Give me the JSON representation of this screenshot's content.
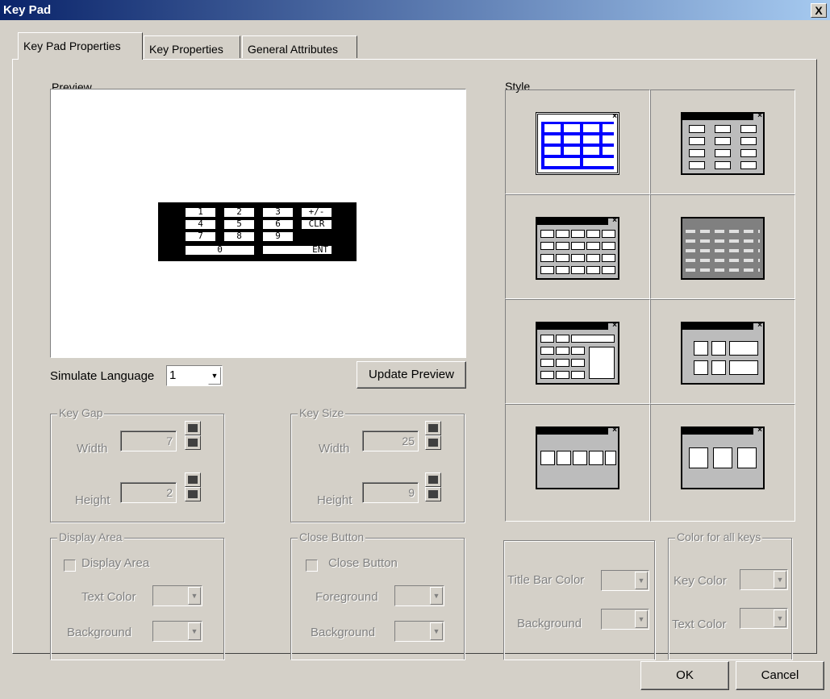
{
  "window": {
    "title": "Key Pad",
    "close_symbol": "X"
  },
  "tabs": [
    {
      "label": "Key Pad Properties",
      "active": true
    },
    {
      "label": "Key  Properties",
      "active": false
    },
    {
      "label": "General Attributes",
      "active": false
    }
  ],
  "preview": {
    "label": "Preview",
    "keypad_keys": [
      "1",
      "2",
      "3",
      "+/-",
      "4",
      "5",
      "6",
      "CLR",
      "7",
      "8",
      "9",
      "0",
      "ENT"
    ]
  },
  "simulate_language": {
    "label": "Simulate Language",
    "value": "1"
  },
  "update_preview_label": "Update Preview",
  "key_gap": {
    "label": "Key Gap",
    "width_label": "Width",
    "width_value": "7",
    "height_label": "Height",
    "height_value": "2"
  },
  "key_size": {
    "label": "Key Size",
    "width_label": "Width",
    "width_value": "25",
    "height_label": "Height",
    "height_value": "9"
  },
  "display_area": {
    "label": "Display Area",
    "checkbox_label": "Display Area",
    "text_color_label": "Text Color",
    "background_label": "Background"
  },
  "close_button": {
    "label": "Close Button",
    "checkbox_label": "Close Button",
    "foreground_label": "Foreground",
    "background_label": "Background"
  },
  "style": {
    "label": "Style",
    "selected_index": 0,
    "options_count": 8
  },
  "title_bar": {
    "title_bar_color_label": "Title Bar Color",
    "background_label": "Background"
  },
  "color_all_keys": {
    "label": "Color for all keys",
    "key_color_label": "Key Color",
    "text_color_label": "Text Color"
  },
  "buttons": {
    "ok": "OK",
    "cancel": "Cancel"
  },
  "colors": {
    "title_start": "#0a246a",
    "title_end": "#a6caf0",
    "face": "#d4d0c8",
    "selected_style_blue": "#0000ff"
  }
}
